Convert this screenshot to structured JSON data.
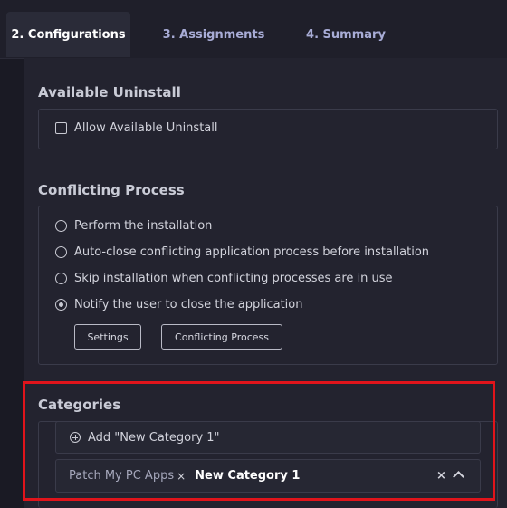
{
  "tabs": [
    {
      "label": "2. Configurations",
      "active": true
    },
    {
      "label": "3. Assignments",
      "active": false
    },
    {
      "label": "4. Summary",
      "active": false
    }
  ],
  "available_uninstall": {
    "title": "Available Uninstall",
    "checkbox_label": "Allow Available Uninstall",
    "checked": false
  },
  "conflicting_process": {
    "title": "Conflicting Process",
    "options": [
      {
        "label": "Perform the installation",
        "selected": false
      },
      {
        "label": "Auto-close conflicting application process before installation",
        "selected": false
      },
      {
        "label": "Skip installation when conflicting processes are in use",
        "selected": false
      },
      {
        "label": "Notify the user to close the application",
        "selected": true
      }
    ],
    "settings_button": "Settings",
    "conflicting_process_button": "Conflicting Process"
  },
  "categories": {
    "title": "Categories",
    "add_option": "Add \"New Category 1\"",
    "selected_tag": "Patch My PC Apps",
    "tag_remove": "×",
    "input_value": "New Category 1",
    "clear_icon": "×"
  },
  "colors": {
    "highlight": "#e0141b",
    "background": "#1a1a24"
  }
}
